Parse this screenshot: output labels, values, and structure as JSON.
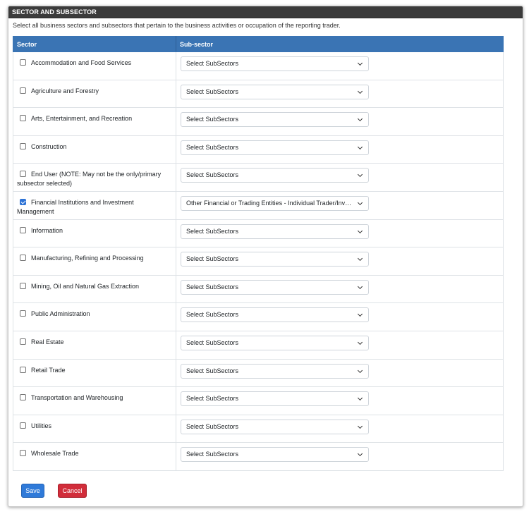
{
  "panel": {
    "title": "SECTOR AND SUBSECTOR",
    "instructions": "Select all business sectors and subsectors that pertain to the business activities or occupation of the reporting trader."
  },
  "table": {
    "headers": {
      "sector": "Sector",
      "subsector": "Sub-sector"
    },
    "rows": [
      {
        "sector": "Accommodation and Food Services",
        "checked": false,
        "subsector": "Select SubSectors"
      },
      {
        "sector": "Agriculture and Forestry",
        "checked": false,
        "subsector": "Select SubSectors"
      },
      {
        "sector": "Arts, Entertainment, and Recreation",
        "checked": false,
        "subsector": "Select SubSectors"
      },
      {
        "sector": "Construction",
        "checked": false,
        "subsector": "Select SubSectors"
      },
      {
        "sector": "End User (NOTE: May not be the only/primary subsector selected)",
        "checked": false,
        "subsector": "Select SubSectors"
      },
      {
        "sector": "Financial Institutions and Investment Management",
        "checked": true,
        "subsector": "Other Financial or Trading Entities - Individual Trader/Inve..."
      },
      {
        "sector": "Information",
        "checked": false,
        "subsector": "Select SubSectors"
      },
      {
        "sector": "Manufacturing, Refining and Processing",
        "checked": false,
        "subsector": "Select SubSectors"
      },
      {
        "sector": "Mining, Oil and Natural Gas Extraction",
        "checked": false,
        "subsector": "Select SubSectors"
      },
      {
        "sector": "Public Administration",
        "checked": false,
        "subsector": "Select SubSectors"
      },
      {
        "sector": "Real Estate",
        "checked": false,
        "subsector": "Select SubSectors"
      },
      {
        "sector": "Retail Trade",
        "checked": false,
        "subsector": "Select SubSectors"
      },
      {
        "sector": "Transportation and Warehousing",
        "checked": false,
        "subsector": "Select SubSectors"
      },
      {
        "sector": "Utilities",
        "checked": false,
        "subsector": "Select SubSectors"
      },
      {
        "sector": "Wholesale Trade",
        "checked": false,
        "subsector": "Select SubSectors"
      }
    ]
  },
  "buttons": {
    "save": "Save",
    "cancel": "Cancel"
  },
  "colors": {
    "header_bar": "#3b3b3b",
    "table_header": "#3a74b4",
    "save": "#2f7ad9",
    "cancel": "#d12d3a",
    "checkbox_checked": "#2d73d6"
  }
}
